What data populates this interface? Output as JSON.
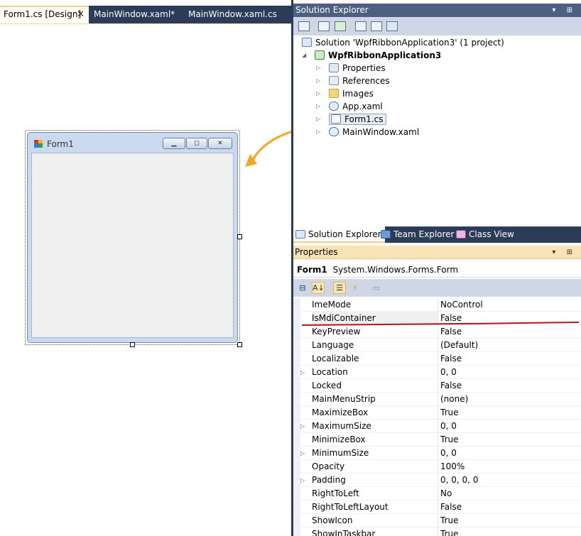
{
  "doc_tabs": [
    {
      "label": "Form1.cs [Design]",
      "close": "✕"
    },
    {
      "label": "MainWindow.xaml*"
    },
    {
      "label": "MainWindow.xaml.cs"
    }
  ],
  "designer": {
    "form_title": "Form1",
    "caption_buttons": [
      "▁",
      "◻",
      "✕"
    ]
  },
  "solution_explorer": {
    "title": "Solution Explorer",
    "header_buttons": "▾ ⊞",
    "solution_label": "Solution 'WpfRibbonApplication3' (1 project)",
    "project_label": "WpfRibbonApplication3",
    "items": [
      {
        "label": "Properties"
      },
      {
        "label": "References"
      },
      {
        "label": "Images"
      },
      {
        "label": "App.xaml"
      },
      {
        "label": "Form1.cs"
      },
      {
        "label": "MainWindow.xaml"
      }
    ],
    "expand_glyph": "▷",
    "collapse_glyph": "◢"
  },
  "bottom_tabs": [
    {
      "label": "Solution Explorer"
    },
    {
      "label": "Team Explorer"
    },
    {
      "label": "Class View"
    }
  ],
  "properties": {
    "title": "Properties",
    "header_buttons": "▾ ⊞",
    "object_name": "Form1",
    "object_type": "System.Windows.Forms.Form",
    "toolbar_glyphs": [
      "⊟",
      "A↓",
      "☰",
      "⚡",
      "▭"
    ],
    "expand_glyph": "▷",
    "rows": [
      {
        "name": "ImeMode",
        "value": "NoControl"
      },
      {
        "name": "IsMdiContainer",
        "value": "False"
      },
      {
        "name": "KeyPreview",
        "value": "False"
      },
      {
        "name": "Language",
        "value": "(Default)"
      },
      {
        "name": "Localizable",
        "value": "False"
      },
      {
        "name": "Location",
        "value": "0, 0"
      },
      {
        "name": "Locked",
        "value": "False"
      },
      {
        "name": "MainMenuStrip",
        "value": "(none)"
      },
      {
        "name": "MaximizeBox",
        "value": "True"
      },
      {
        "name": "MaximumSize",
        "value": "0, 0"
      },
      {
        "name": "MinimizeBox",
        "value": "True"
      },
      {
        "name": "MinimumSize",
        "value": "0, 0"
      },
      {
        "name": "Opacity",
        "value": "100%"
      },
      {
        "name": "Padding",
        "value": "0, 0, 0, 0"
      },
      {
        "name": "RightToLeft",
        "value": "No"
      },
      {
        "name": "RightToLeftLayout",
        "value": "False"
      },
      {
        "name": "ShowIcon",
        "value": "True"
      },
      {
        "name": "ShowInTaskbar",
        "value": "True"
      }
    ]
  },
  "colors": {
    "chrome_dark": "#2b3c59",
    "tool_header": "#4d6082",
    "properties_header": "#f7e3b6",
    "accent_arrow": "#f5a623",
    "underline_red": "#b01818"
  }
}
